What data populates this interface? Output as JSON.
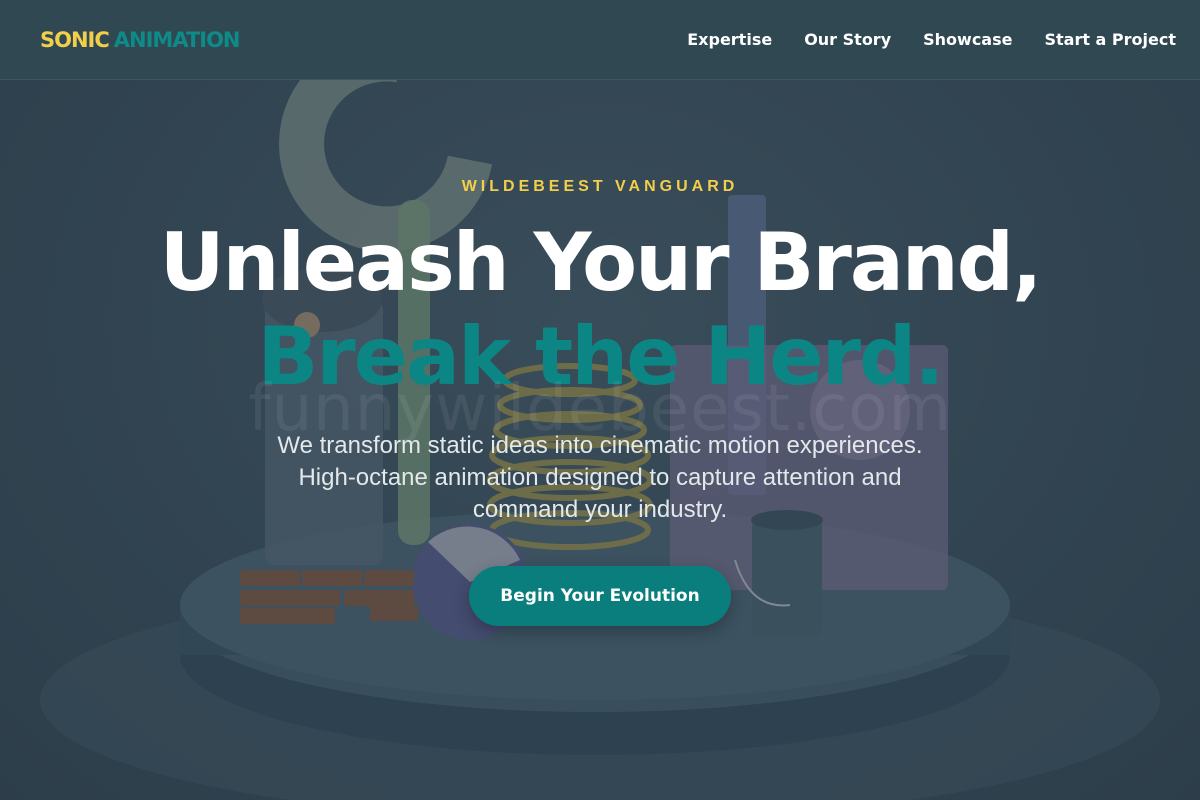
{
  "brand": {
    "part1": "SONIC",
    "part2": "ANIMATION"
  },
  "nav": {
    "items": [
      {
        "label": "Expertise"
      },
      {
        "label": "Our Story"
      },
      {
        "label": "Showcase"
      },
      {
        "label": "Start a Project"
      }
    ]
  },
  "hero": {
    "eyebrow": "WILDEBEEST VANGUARD",
    "headline_line1": "Unleash Your Brand,",
    "headline_line2": "Break the Herd.",
    "watermark": "funnywildebeest.com",
    "subtitle": "We transform static ideas into cinematic motion experiences. High-octane animation designed to capture attention and command your industry.",
    "cta_label": "Begin Your Evolution"
  },
  "colors": {
    "brand_yellow": "#f2cf4a",
    "brand_teal": "#0c8684",
    "navbar_bg": "#2f4852"
  }
}
